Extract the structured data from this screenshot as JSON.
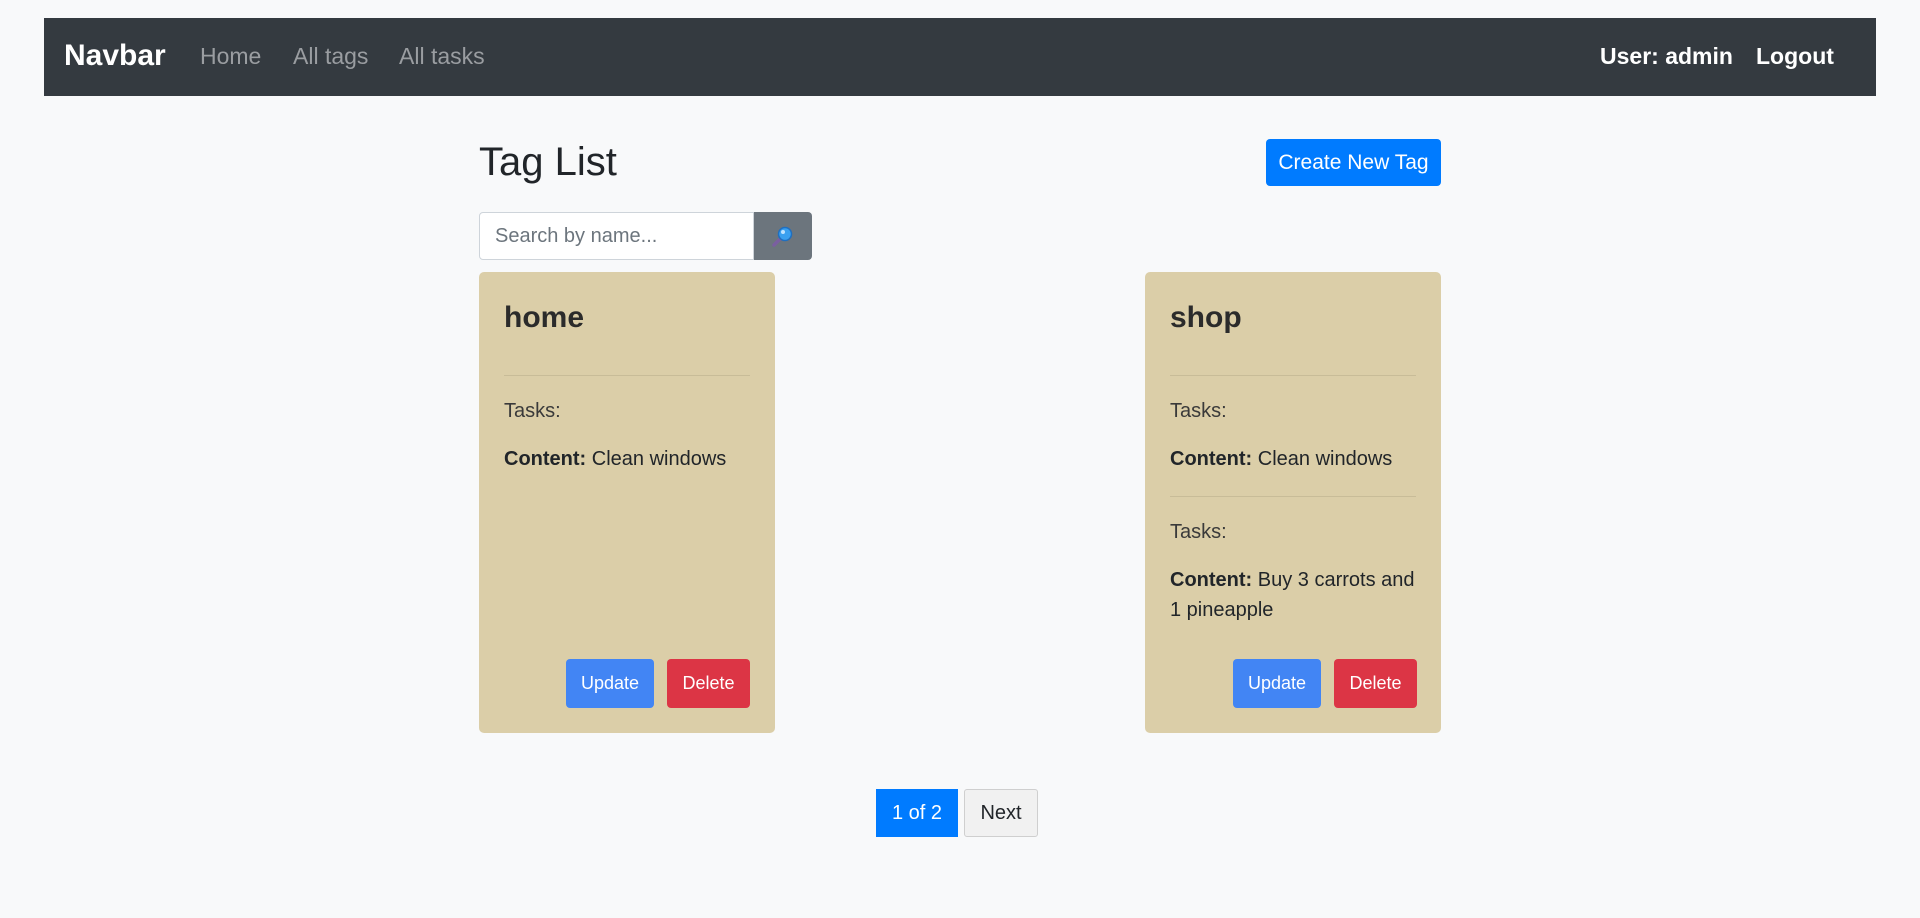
{
  "navbar": {
    "brand": "Navbar",
    "links": [
      "Home",
      "All tags",
      "All tasks"
    ],
    "user_label": "User: admin",
    "logout_label": "Logout"
  },
  "page": {
    "title": "Tag List",
    "create_button": "Create New Tag"
  },
  "search": {
    "placeholder": "Search by name...",
    "button_icon": "magnifier-icon"
  },
  "cards": [
    {
      "title": "home",
      "tasks": [
        {
          "tasks_label": "Tasks:",
          "content_label": "Content:",
          "content": "Clean windows"
        }
      ],
      "update_label": "Update",
      "delete_label": "Delete"
    },
    {
      "title": "shop",
      "tasks": [
        {
          "tasks_label": "Tasks:",
          "content_label": "Content:",
          "content": "Clean windows"
        },
        {
          "tasks_label": "Tasks:",
          "content_label": "Content:",
          "content": "Buy 3 carrots and 1 pineapple"
        }
      ],
      "update_label": "Update",
      "delete_label": "Delete"
    }
  ],
  "pagination": {
    "current": "1 of 2",
    "next": "Next"
  },
  "colors": {
    "navbar_bg": "#343a40",
    "primary": "#007bff",
    "card_bg": "#dbcea8",
    "update": "#4285f4",
    "delete": "#dc3545",
    "search_button": "#6c757d"
  }
}
